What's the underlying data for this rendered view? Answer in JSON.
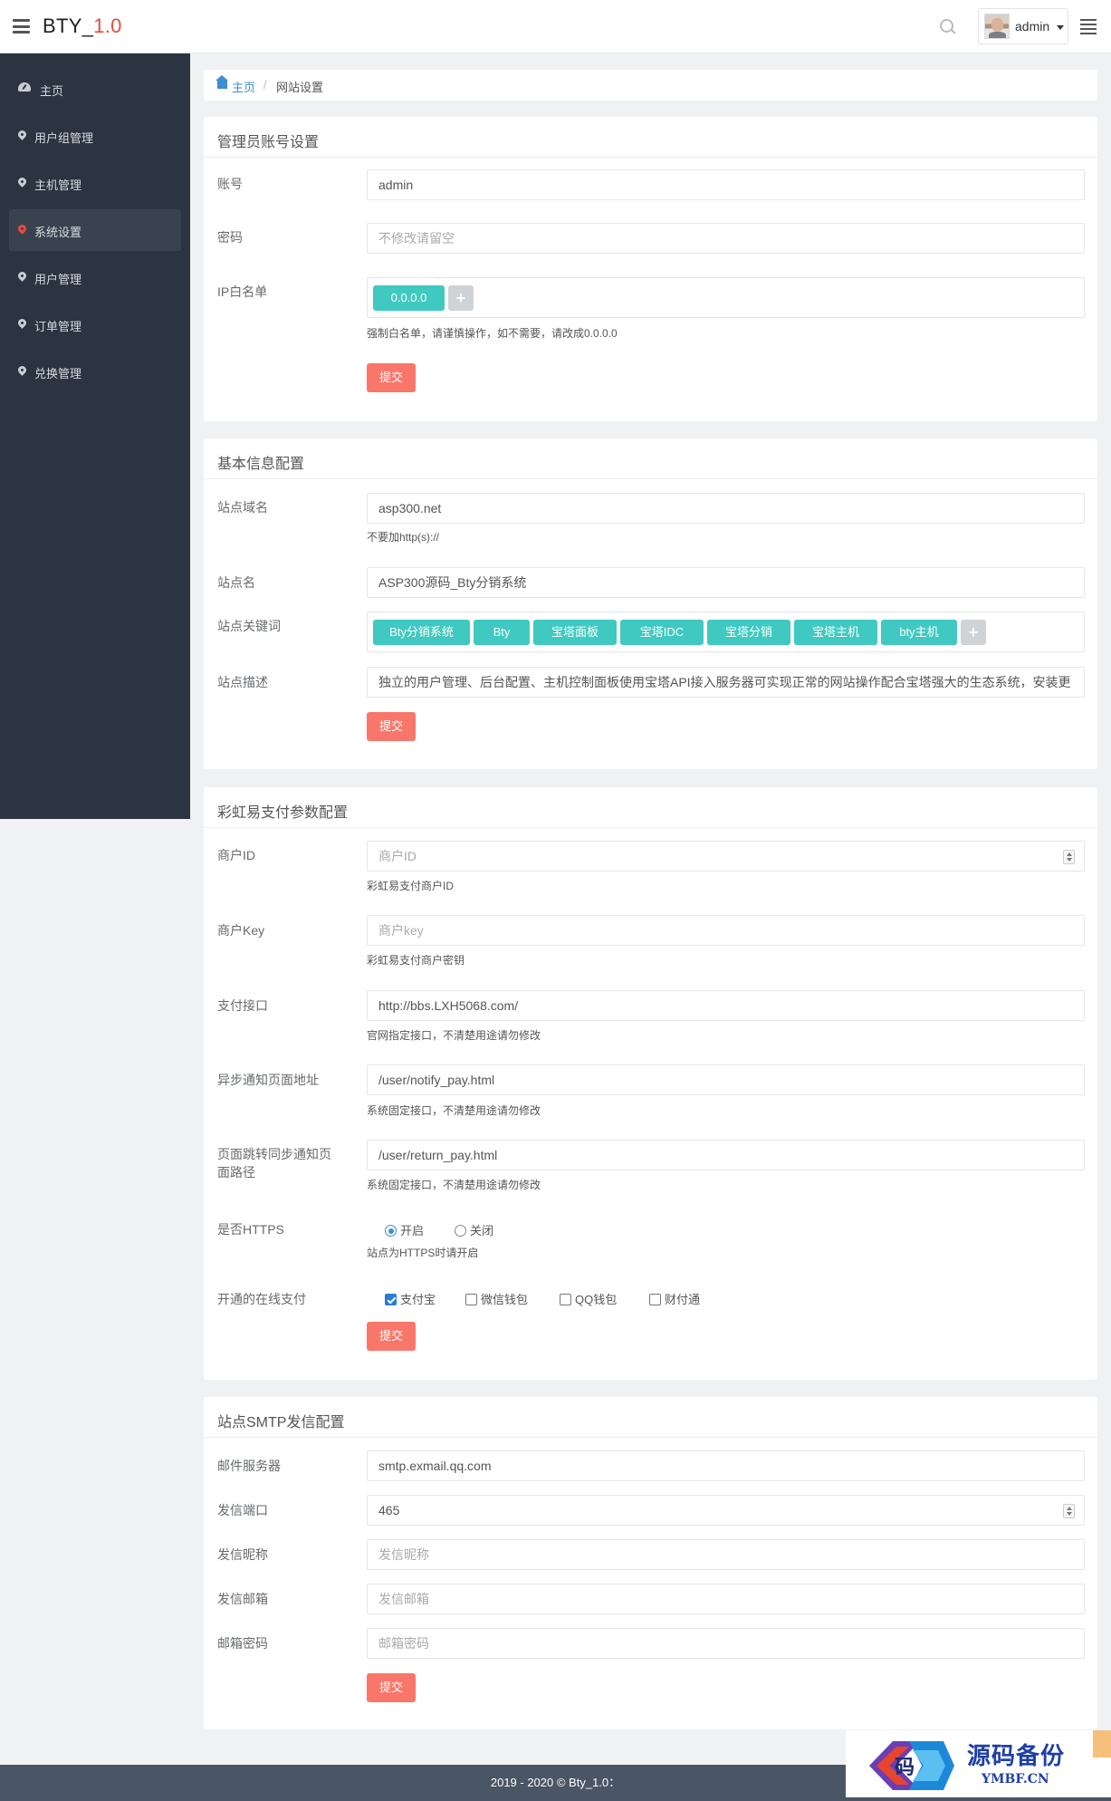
{
  "app": {
    "brand": "BTY_",
    "version": "1.0",
    "user": "admin"
  },
  "sidebar": {
    "items": [
      {
        "label": "主页"
      },
      {
        "label": "用户组管理"
      },
      {
        "label": "主机管理"
      },
      {
        "label": "系统设置"
      },
      {
        "label": "用户管理"
      },
      {
        "label": "订单管理"
      },
      {
        "label": "兑换管理"
      }
    ],
    "active": "系统设置"
  },
  "breadcrumb": {
    "home": "主页",
    "sep": "/",
    "current": "网站设置"
  },
  "admin": {
    "title": "管理员账号设置",
    "account_label": "账号",
    "account_value": "admin",
    "password_label": "密码",
    "password_placeholder": "不修改请留空",
    "ip_label": "IP白名单",
    "ip_tags": [
      "0.0.0.0"
    ],
    "add": "+",
    "ip_help": "强制白名单，请谨慎操作，如不需要，请改成0.0.0.0",
    "submit": "提交"
  },
  "basic": {
    "title": "基本信息配置",
    "domain_label": "站点域名",
    "domain_value": "asp300.net",
    "domain_help": "不要加http(s)://",
    "name_label": "站点名",
    "name_value": "ASP300源码_Bty分销系统",
    "keywords_label": "站点关键词",
    "keywords": [
      "Bty分销系统",
      "Bty",
      "宝塔面板",
      "宝塔IDC",
      "宝塔分销",
      "宝塔主机",
      "bty主机"
    ],
    "add": "+",
    "desc_label": "站点描述",
    "desc_value": "独立的用户管理、后台配置、主机控制面板使用宝塔API接入服务器可实现正常的网站操作配合宝塔强大的生态系统，安装更",
    "submit": "提交"
  },
  "pay": {
    "title": "彩虹易支付参数配置",
    "pid_label": "商户ID",
    "pid_placeholder": "商户ID",
    "pid_help": "彩虹易支付商户ID",
    "key_label": "商户Key",
    "key_placeholder": "商户key",
    "key_help": "彩虹易支付商户密钥",
    "api_label": "支付接口",
    "api_value": "http://bbs.LXH5068.com/",
    "api_help": "官网指定接口，不清楚用途请勿修改",
    "notify_label": "异步通知页面地址",
    "notify_value": "/user/notify_pay.html",
    "notify_help": "系统固定接口，不清楚用途请勿修改",
    "return_label_1": "页面跳转同步通知页",
    "return_label_2": "面路径",
    "return_value": "/user/return_pay.html",
    "return_help": "系统固定接口，不清楚用途请勿修改",
    "https_label": "是否HTTPS",
    "https_on": "开启",
    "https_off": "关闭",
    "https_help": "站点为HTTPS时请开启",
    "https_enabled": true,
    "methods_label": "开通的在线支付",
    "methods": [
      {
        "label": "支付宝",
        "checked": true
      },
      {
        "label": "微信钱包",
        "checked": false
      },
      {
        "label": "QQ钱包",
        "checked": false
      },
      {
        "label": "财付通",
        "checked": false
      }
    ],
    "submit": "提交"
  },
  "smtp": {
    "title": "站点SMTP发信配置",
    "server_label": "邮件服务器",
    "server_value": "smtp.exmail.qq.com",
    "port_label": "发信端口",
    "port_value": "465",
    "nick_label": "发信昵称",
    "nick_placeholder": "发信昵称",
    "mail_label": "发信邮箱",
    "mail_placeholder": "发信邮箱",
    "pass_label": "邮箱密码",
    "pass_placeholder": "邮箱密码",
    "submit": "提交"
  },
  "footer": {
    "text": "2019 - 2020 © Bty_1.0："
  },
  "watermark": {
    "cn": "源码备份",
    "en": "YMBF.CN",
    "logo_char": "码"
  },
  "colors": {
    "accent": "#f8776a",
    "tag": "#40c9c0",
    "sidebar": "#2b3440",
    "link": "#3e8ed0",
    "brand_version": "#e74c3c"
  }
}
